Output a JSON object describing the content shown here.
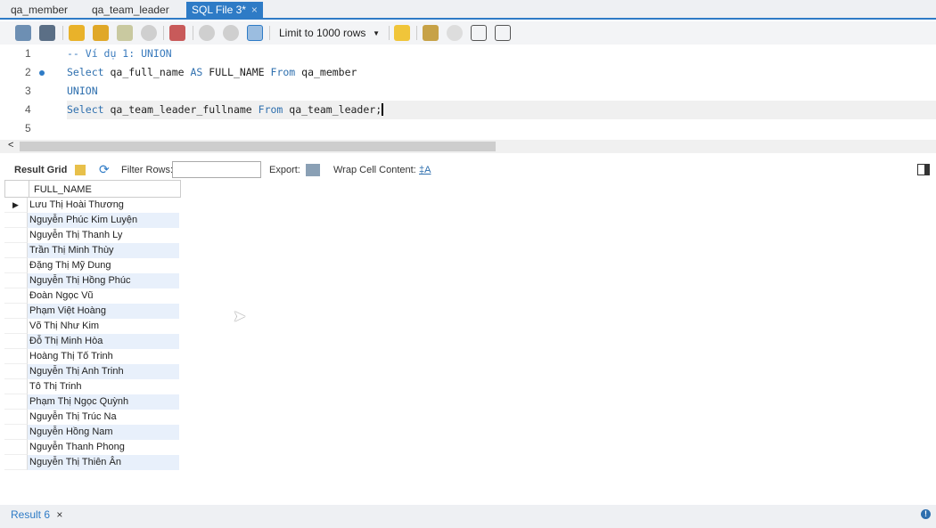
{
  "tabs": [
    {
      "label": "qa_member"
    },
    {
      "label": "qa_team_leader"
    },
    {
      "label": "SQL File 3*",
      "close": "×"
    }
  ],
  "toolbar": {
    "limit": "Limit to 1000 rows"
  },
  "editor": {
    "lines": [
      {
        "num": "1",
        "parts": [
          {
            "t": "-- Ví dụ 1: UNION",
            "c": "cm"
          }
        ]
      },
      {
        "num": "2",
        "parts": [
          {
            "t": "Select",
            "c": "kw"
          },
          {
            "t": " qa_full_name ",
            "c": ""
          },
          {
            "t": "AS",
            "c": "kw"
          },
          {
            "t": " FULL_NAME ",
            "c": ""
          },
          {
            "t": "From",
            "c": "kw"
          },
          {
            "t": " qa_member",
            "c": ""
          }
        ]
      },
      {
        "num": "3",
        "parts": [
          {
            "t": "UNION",
            "c": "kw"
          }
        ]
      },
      {
        "num": "4",
        "parts": [
          {
            "t": "Select",
            "c": "kw"
          },
          {
            "t": " qa_team_leader_fullname ",
            "c": ""
          },
          {
            "t": "From",
            "c": "kw"
          },
          {
            "t": " qa_team_leader;",
            "c": ""
          }
        ]
      },
      {
        "num": "5",
        "parts": []
      }
    ]
  },
  "result_toolbar": {
    "result_grid": "Result Grid",
    "filter_rows": "Filter Rows:",
    "export": "Export:",
    "wrap": "Wrap Cell Content:"
  },
  "grid": {
    "column": "FULL_NAME",
    "rows": [
      "Lưu Thị Hoài Thương",
      "Nguyễn Phúc Kim Luyện",
      "Nguyễn Thị Thanh Ly",
      "Trần Thị Minh Thùy",
      "Đặng Thị Mỹ Dung",
      "Nguyễn Thị Hồng Phúc",
      "Đoàn Ngọc Vũ",
      "Phạm Việt Hoàng",
      "Võ Thị Như Kim",
      "Đỗ Thị Minh Hòa",
      "Hoàng Thị Tố Trinh",
      "Nguyễn Thị Anh Trinh",
      "Tô Thị Trinh",
      "Phạm Thị Ngọc Quỳnh",
      "Nguyễn Thị Trúc Na",
      "Nguyễn Hồng Nam",
      "Nguyễn Thanh Phong",
      "Nguyễn Thị Thiên Ân"
    ]
  },
  "bottom": {
    "tab": "Result 6",
    "close": "×"
  }
}
